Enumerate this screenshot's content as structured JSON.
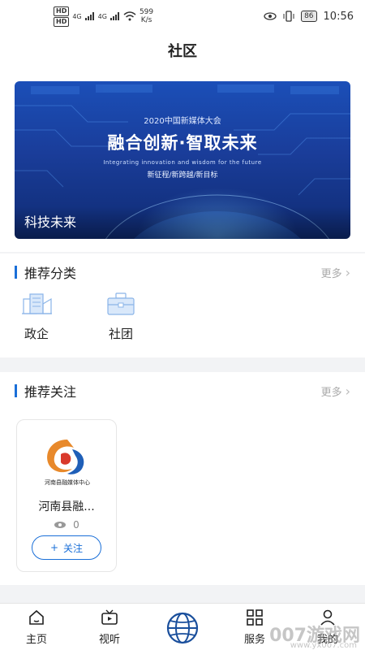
{
  "status_bar": {
    "tag1": "HD",
    "tag2": "HD",
    "net1": "4G",
    "net2": "4G",
    "speed_value": "599",
    "speed_unit": "K/s",
    "battery": "86",
    "time": "10:56"
  },
  "header": {
    "title": "社区"
  },
  "banner": {
    "event": "2020中国新媒体大会",
    "headline": "融合创新·智取未来",
    "english": "Integrating innovation and wisdom for the future",
    "tags": "新征程/新跨越/新目标",
    "caption": "科技未来"
  },
  "categories": {
    "title": "推荐分类",
    "more": "更多",
    "items": [
      {
        "label": "政企",
        "icon": "building-icon"
      },
      {
        "label": "社团",
        "icon": "briefcase-icon"
      }
    ]
  },
  "follows": {
    "title": "推荐关注",
    "more": "更多",
    "cards": [
      {
        "name": "河南县融...",
        "logo_text": "河南县融媒体中心",
        "views": "0",
        "follow_label": "关注",
        "follow_prefix": "+"
      }
    ]
  },
  "tabbar": {
    "items": [
      {
        "label": "主页",
        "icon": "home-icon"
      },
      {
        "label": "视听",
        "icon": "video-icon"
      },
      {
        "label": "",
        "icon": "globe-icon"
      },
      {
        "label": "服务",
        "icon": "grid-icon"
      },
      {
        "label": "我的",
        "icon": "user-icon"
      }
    ]
  },
  "watermark": {
    "text": "007游戏网",
    "url": "www.yx007.com"
  },
  "colors": {
    "accent": "#1a6fd8",
    "banner_dark": "#0f2b73",
    "banner_light": "#1b4fb8"
  }
}
